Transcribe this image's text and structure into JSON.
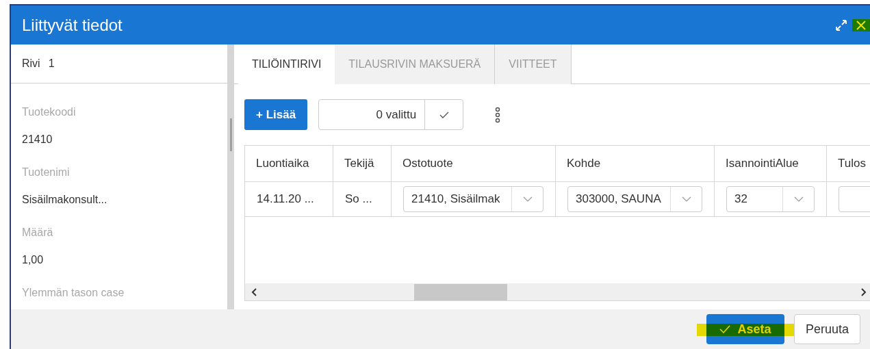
{
  "window": {
    "title": "Liittyvät tiedot"
  },
  "left_panel": {
    "row_label": "Rivi",
    "row_number": "1",
    "fields": [
      {
        "label": "Tuotekoodi",
        "value": "21410"
      },
      {
        "label": "Tuotenimi",
        "value": "Sisäilmakonsult..."
      },
      {
        "label": "Määrä",
        "value": "1,00"
      },
      {
        "label": "Ylemmän tason case"
      }
    ]
  },
  "tabs": [
    {
      "label": "TILIÖINTIRIVI",
      "selected": true
    },
    {
      "label": "TILAUSRIVIN MAKSUERÄ",
      "selected": false
    },
    {
      "label": "VIITTEET",
      "selected": false
    }
  ],
  "toolbar": {
    "add_button": "+ Lisää",
    "selection_count": "0 valittu"
  },
  "table": {
    "columns": [
      "Luontiaika",
      "Tekijä",
      "Ostotuote",
      "Kohde",
      "IsannointiAlue",
      "Tulos"
    ],
    "rows": [
      [
        {
          "kind": "text",
          "value": "14.11.20 ..."
        },
        {
          "kind": "text",
          "value": "So ..."
        },
        {
          "kind": "select",
          "value": "21410, Sisäilmak"
        },
        {
          "kind": "select",
          "value": "303000, SAUNA"
        },
        {
          "kind": "select",
          "value": "32"
        },
        {
          "kind": "select"
        }
      ]
    ]
  },
  "footer": {
    "buttons": [
      {
        "label": "Aseta",
        "primary": true,
        "highlighted": true
      },
      {
        "label": "Peruuta",
        "primary": false,
        "highlighted": false
      }
    ]
  },
  "close_highlighted": true
}
